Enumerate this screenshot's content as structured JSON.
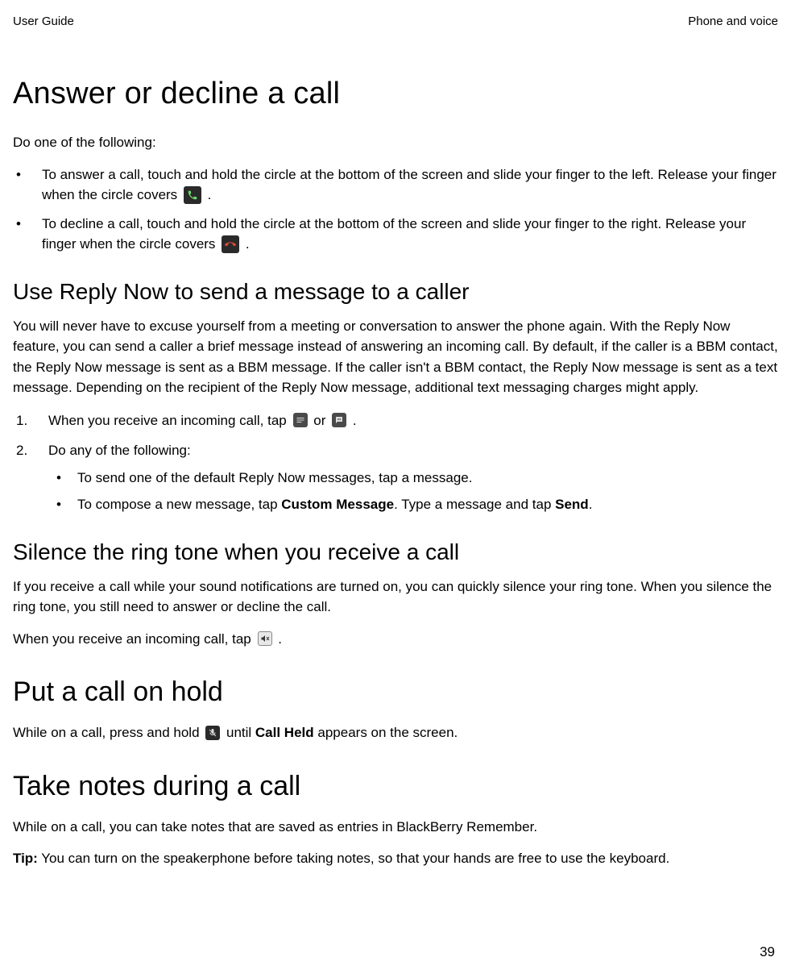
{
  "header": {
    "left": "User Guide",
    "right": "Phone and voice"
  },
  "section_answer": {
    "title": "Answer or decline a call",
    "intro": "Do one of the following:",
    "bullets": [
      {
        "pre": "To answer a call, touch and hold the circle at the bottom of the screen and slide your finger to the left. Release your finger when the circle covers ",
        "icon": "phone-answer-icon",
        "post": " ."
      },
      {
        "pre": "To decline a call, touch and hold the circle at the bottom of the screen and slide your finger to the right. Release your finger when the circle covers ",
        "icon": "phone-decline-icon",
        "post": " ."
      }
    ]
  },
  "section_reply_now": {
    "title": "Use Reply Now to send a message to a caller",
    "para": "You will never have to excuse yourself from a meeting or conversation to answer the phone again. With the Reply Now feature, you can send a caller a brief message instead of answering an incoming call. By default, if the caller is a BBM contact, the Reply Now message is sent as a BBM message. If the caller isn't a BBM contact, the Reply Now message is sent as a text message. Depending on the recipient of the Reply Now message, additional text messaging charges might apply.",
    "step1_pre": "When you receive an incoming call, tap ",
    "step1_or": " or ",
    "step1_post": " .",
    "step1_icon1": "message-list-icon",
    "step1_icon2": "bbm-dots-icon",
    "step2": "Do any of the following:",
    "sub_bullets": [
      {
        "text": "To send one of the default Reply Now messages, tap a message."
      },
      {
        "pre": "To compose a new message, tap ",
        "b1": "Custom Message",
        "mid": ". Type a message and tap ",
        "b2": "Send",
        "post": "."
      }
    ]
  },
  "section_silence": {
    "title": "Silence the ring tone when you receive a call",
    "para": "If you receive a call while your sound notifications are turned on, you can quickly silence your ring tone. When you silence the ring tone, you still need to answer or decline the call.",
    "line_pre": "When you receive an incoming call, tap ",
    "line_icon": "speaker-mute-icon",
    "line_post": " ."
  },
  "section_hold": {
    "title": "Put a call on hold",
    "pre": "While on a call, press and hold ",
    "icon": "mic-mute-icon",
    "mid": " until ",
    "bold": "Call Held",
    "post": " appears on the screen."
  },
  "section_notes": {
    "title": "Take notes during a call",
    "para": "While on a call, you can take notes that are saved as entries in BlackBerry Remember.",
    "tip_label": "Tip:",
    "tip_text": " You can turn on the speakerphone before taking notes, so that your hands are free to use the keyboard."
  },
  "page_number": "39"
}
